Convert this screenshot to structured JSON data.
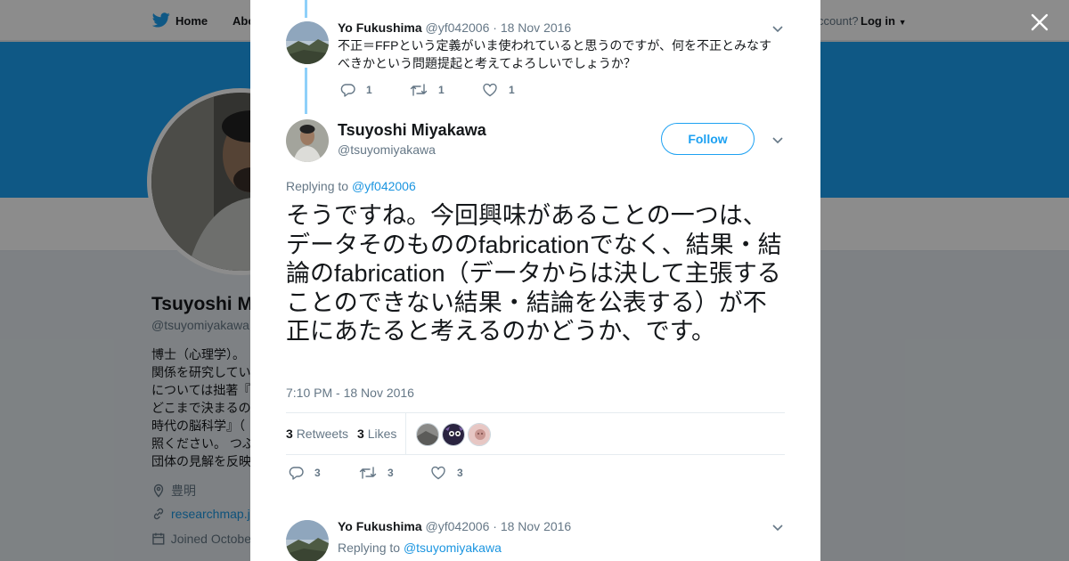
{
  "nav": {
    "home_label": "Home",
    "about_label": "Abo",
    "have_account": "ccount?",
    "login_label": "Log in"
  },
  "profile": {
    "name": "Tsuyoshi M",
    "handle": "@tsuyomiyakawa",
    "bio_lines": [
      "博士（心理学）。",
      "関係を研究してい",
      "については拙著『",
      "どこまで決まるの",
      "時代の脳科学』（",
      "照ください。 つぶ",
      "団体の見解を反映"
    ],
    "location": "豊明",
    "website": "researchmap.j",
    "joined": "Joined Octobe"
  },
  "modal": {
    "parent_tweet": {
      "author_name": "Yo Fukushima",
      "author_handle": "@yf042006",
      "date": "· 18 Nov 2016",
      "text": "不正＝FFPという定義がいま使われていると思うのですが、何を不正とみなすべきかという問題提起と考えてよろしいでしょうか？",
      "replies": "1",
      "retweets": "1",
      "likes": "1"
    },
    "main_tweet": {
      "author_name": "Tsuyoshi Miyakawa",
      "author_handle": "@tsuyomiyakawa",
      "follow_label": "Follow",
      "replying_prefix": "Replying to",
      "replying_to": "@yf042006",
      "text": "そうですね。今回興味があることの一つは、データそのもののfabricationでなく、結果・結論のfabrication（データからは決して主張することのできない結果・結論を公表する）が不正にあたると考えるのかどうか、です。",
      "timestamp": "7:10 PM - 18 Nov 2016",
      "retweet_count": "3",
      "retweets_label": "Retweets",
      "like_count": "3",
      "likes_label": "Likes",
      "replies": "3",
      "retweets": "3",
      "likes": "3"
    },
    "reply_tweet": {
      "author_name": "Yo Fukushima",
      "author_handle": "@yf042006",
      "date": "· 18 Nov 2016",
      "replying_prefix": "Replying to",
      "replying_to": "@tsuyomiyakawa"
    }
  },
  "colors": {
    "accent": "#1da1f2",
    "link": "#1b95e0",
    "thread_line": "#8ed0f9",
    "text": "#14171a",
    "muted": "#657786"
  },
  "icons": [
    "twitter-bird-icon",
    "close-icon",
    "chevron-down-icon",
    "reply-icon",
    "retweet-icon",
    "heart-icon",
    "location-icon",
    "link-icon",
    "calendar-icon"
  ]
}
